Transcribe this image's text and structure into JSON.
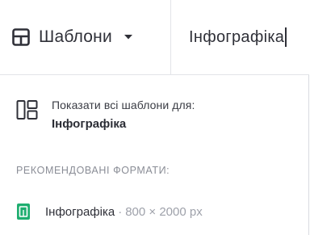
{
  "header": {
    "templates_button": {
      "label": "Шаблони",
      "icon": "grid-icon"
    },
    "search": {
      "value": "Інфографіка",
      "placeholder": ""
    }
  },
  "show_all": {
    "icon": "layout-icon",
    "label": "Показати всі шаблони для:",
    "query": "Інфографіка"
  },
  "recommended": {
    "title": "РЕКОМЕНДОВАНІ ФОРМАТИ:",
    "items": [
      {
        "icon": "document-icon",
        "name": "Інфографіка",
        "separator": "·",
        "dimensions": "800 × 2000 px"
      }
    ]
  },
  "colors": {
    "accent_green": "#1fae70",
    "text": "#2f3038",
    "muted": "#8a8d96",
    "border": "#e2e4e8"
  }
}
